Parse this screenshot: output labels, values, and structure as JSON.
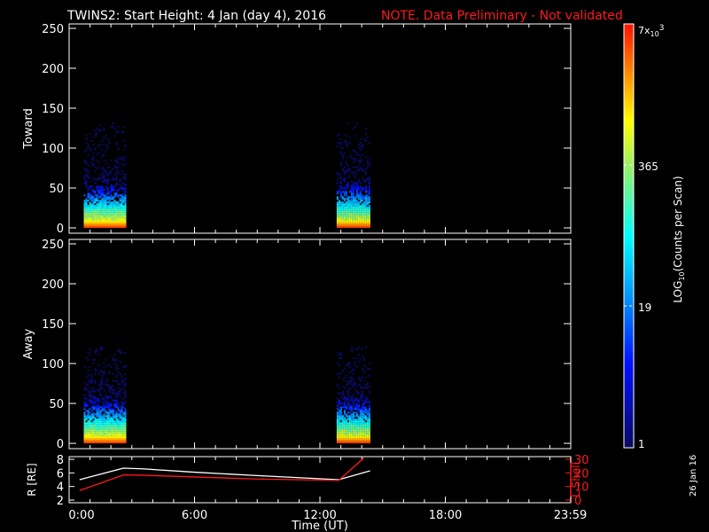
{
  "title": {
    "main": "TWINS2: Start Height:  4 Jan (day   4), 2016",
    "note": "NOTE. Data Preliminary - Not validated",
    "note_color": "#ff1a1a"
  },
  "side_date": "26 Jan 16",
  "chart_data": [
    {
      "type": "heatmap",
      "panel": "Toward",
      "ylabel": "Toward",
      "ylim": [
        0,
        255
      ],
      "yticks": [
        "0",
        "50",
        "100",
        "150",
        "200",
        "250"
      ],
      "xlim_hours": [
        0,
        24
      ],
      "active_intervals_hours": [
        [
          0.7,
          2.7
        ],
        [
          12.8,
          14.4
        ]
      ],
      "max_height": 130
    },
    {
      "type": "heatmap",
      "panel": "Away",
      "ylabel": "Away",
      "ylim": [
        0,
        255
      ],
      "yticks": [
        "0",
        "50",
        "100",
        "150",
        "200",
        "250"
      ],
      "xlim_hours": [
        0,
        24
      ],
      "active_intervals_hours": [
        [
          0.7,
          2.7
        ],
        [
          12.8,
          14.4
        ]
      ],
      "max_height": 120
    },
    {
      "type": "line",
      "panel": "orbit",
      "ylabel": "R [RE]",
      "ylabel_right": "L Shell",
      "ylim": [
        2,
        8
      ],
      "ylim_right": [
        0,
        30
      ],
      "yticks": [
        "2",
        "4",
        "6",
        "8"
      ],
      "yticks_right": [
        "0",
        "10",
        "20",
        "30"
      ],
      "xlabel": "Time (UT)",
      "xticks": [
        "0:00",
        "6:00",
        "12:00",
        "18:00",
        "23:59"
      ],
      "series": [
        {
          "name": "R",
          "color": "#ffffff",
          "x": [
            0.5,
            2.6,
            3.5,
            6,
            9,
            12.9,
            14.4
          ],
          "y": [
            5.0,
            6.7,
            6.6,
            6.1,
            5.6,
            5.0,
            6.3
          ]
        },
        {
          "name": "L Shell",
          "color": "#ff1a1a",
          "x": [
            0.5,
            2.6,
            3.5,
            6,
            9,
            12.9,
            14.1
          ],
          "y": [
            7,
            18.5,
            18.3,
            17,
            15.5,
            14.5,
            31
          ]
        }
      ]
    }
  ],
  "colorbar": {
    "label": "LOG10(Counts per Scan)",
    "label_main": "LOG",
    "label_sub": "10",
    "label_rest": "(Counts per Scan)",
    "ticks": [
      "1",
      "19",
      "365",
      "7x10"
    ],
    "top_exp_sub": "10",
    "top_exp": "3",
    "top_mantissa": "7x"
  }
}
